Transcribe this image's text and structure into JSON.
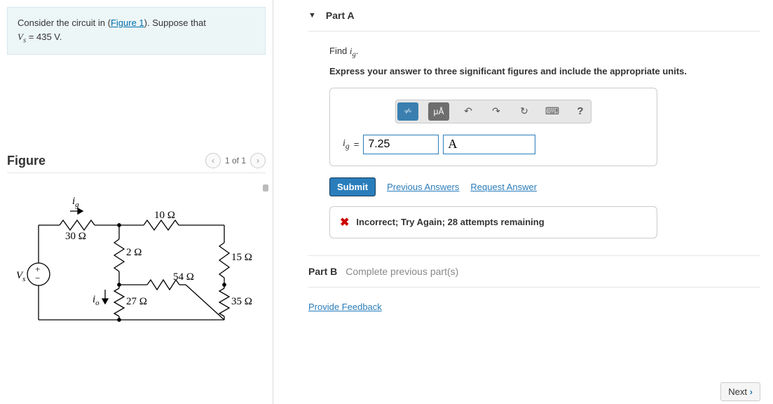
{
  "prompt": {
    "pre": "Consider the circuit in (",
    "link": "Figure 1",
    "post": "). Suppose that",
    "line2_pre": "V",
    "line2_sub": "s",
    "line2_post": " = 435 V."
  },
  "figure": {
    "title": "Figure",
    "pager_text": "1 of 1",
    "labels": {
      "ig": "i",
      "ig_sub": "g",
      "r30": "30 Ω",
      "r10": "10 Ω",
      "r2": "2 Ω",
      "r15": "15 Ω",
      "io": "i",
      "io_sub": "o",
      "r27": "27 Ω",
      "r54": "54 Ω",
      "r35": "35 Ω",
      "vs": "V",
      "vs_sub": "s"
    }
  },
  "partA": {
    "title": "Part A",
    "find_pre": "Find ",
    "find_var": "i",
    "find_sub": "g",
    "find_post": ".",
    "instruction": "Express your answer to three significant figures and include the appropriate units.",
    "toolbar": {
      "template": "▫⁄▫",
      "units": "μÅ",
      "undo": "↶",
      "redo": "↷",
      "reset": "↻",
      "keyboard": "⌨",
      "help": "?"
    },
    "eq_var": "i",
    "eq_sub": "g",
    "eq_op": " = ",
    "value_input": "7.25",
    "unit_input": "A",
    "submit": "Submit",
    "previous_answers": "Previous Answers",
    "request_answer": "Request Answer",
    "feedback": "Incorrect; Try Again; 28 attempts remaining"
  },
  "partB": {
    "label": "Part B",
    "sub": "Complete previous part(s)"
  },
  "provide_feedback": "Provide Feedback",
  "next": "Next"
}
